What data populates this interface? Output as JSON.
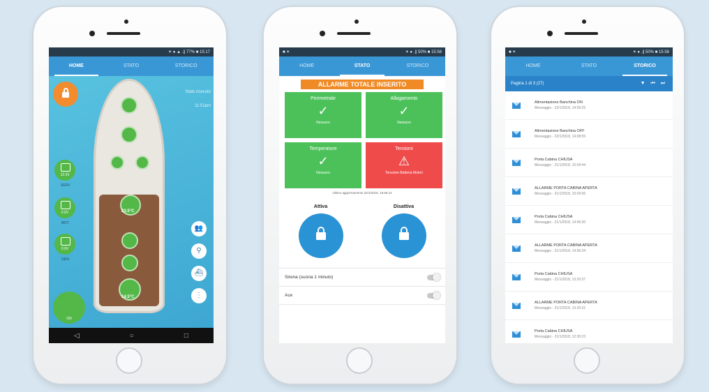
{
  "tabs": [
    "HOME",
    "STATO",
    "STORICO"
  ],
  "phone1": {
    "statusbar_right": "✶ ● ▲ .∥ 77% ■ 15:17",
    "info_lines": [
      "Stato ricevuto",
      "11:51pm"
    ],
    "sensors": [
      {
        "value": "12.3V",
        "label": "SERV"
      },
      {
        "value": "0.0V",
        "label": "MOT"
      },
      {
        "value": "0.0V",
        "label": "GEN"
      }
    ],
    "temps": [
      "23.5°C",
      "14.5°C"
    ],
    "vessel_status": "ON",
    "nav": [
      "◁",
      "○",
      "□"
    ],
    "side_icons": [
      "people-icon",
      "location-icon",
      "boat-icon",
      "menu-icon"
    ]
  },
  "phone2": {
    "statusbar_left": "■ ✶",
    "statusbar_right": "✶ ● .∥ 50% ■ 15:58",
    "alarm_title": "ALLARME TOTALE INSERITO",
    "cells": [
      {
        "title": "Perimetrale",
        "sub": "Nessuno",
        "state": "ok"
      },
      {
        "title": "Allagamento",
        "sub": "Nessuno",
        "state": "ok"
      },
      {
        "title": "Temperature",
        "sub": "Nessuno",
        "state": "ok"
      },
      {
        "title": "Tensioni",
        "sub": "Tensione Batteria Motori",
        "state": "alert"
      }
    ],
    "last_update": "Ultimo aggiornamento 22/1/2018, 15:56:14",
    "activate_label": "Attiva",
    "deactivate_label": "Disattiva",
    "switches": [
      "Sirena (suona 1 minuto)",
      "Aux"
    ]
  },
  "phone3": {
    "statusbar_left": "■ ✶",
    "statusbar_right": "✶ ● .∥ 50% ■ 15:58",
    "page_label": "Pagina 1 di 3 (27)",
    "page_controls": "▼ ⏮ ⏭",
    "messages": [
      {
        "title": "Alimentazione Banchina ON",
        "date": "Messaggio - 22/1/2018, 14:59:25"
      },
      {
        "title": "Alimentazione Banchina OFF",
        "date": "Messaggio - 22/1/2018, 14:08:55"
      },
      {
        "title": "Porta Cabina CHIUSA",
        "date": "Messaggio - 21/1/2018, 15:04:44"
      },
      {
        "title": "ALLARME PORTA CABINA APERTA",
        "date": "Messaggio - 21/1/2018, 15:04:36"
      },
      {
        "title": "Porta Cabina CHIUSA",
        "date": "Messaggio - 21/1/2018, 14:56:30"
      },
      {
        "title": "ALLARME PORTA CABINA APERTA",
        "date": "Messaggio - 21/1/2018, 14:56:24"
      },
      {
        "title": "Porta Cabina CHIUSA",
        "date": "Messaggio - 21/1/2018, 13:20:37"
      },
      {
        "title": "ALLARME PORTA CABINA APERTA",
        "date": "Messaggio - 21/1/2018, 13:20:31"
      },
      {
        "title": "Porta Cabina CHIUSA",
        "date": "Messaggio - 21/1/2018, 12:30:23"
      }
    ]
  }
}
